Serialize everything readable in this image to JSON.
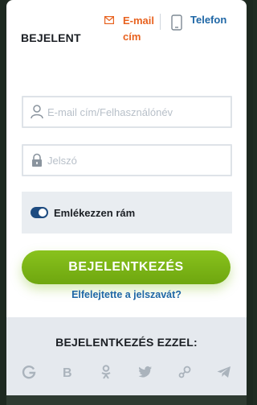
{
  "header": {
    "title": "BEJELENT",
    "tab_email_label": "E-mail cím",
    "tab_phone_label": "Telefon"
  },
  "form": {
    "email_placeholder": "E-mail cím/Felhasználónév",
    "email_value": "",
    "password_placeholder": "Jelszó",
    "password_value": ""
  },
  "remember": {
    "label": "Emlékezzen rám",
    "checked": true
  },
  "actions": {
    "login_label": "BEJELENTKEZÉS",
    "forgot_label": "Elfelejtette a jelszavát?"
  },
  "social": {
    "title": "BEJELENTKEZÉS EZZEL:",
    "providers": [
      "google-icon",
      "vk-icon",
      "odnoklassniki-icon",
      "twitter-icon",
      "steam-icon",
      "telegram-icon"
    ]
  },
  "colors": {
    "accent_orange": "#e8621f",
    "link_blue": "#1f67a6",
    "button_green": "#7cb518",
    "toggle_navy": "#1d4b80"
  }
}
